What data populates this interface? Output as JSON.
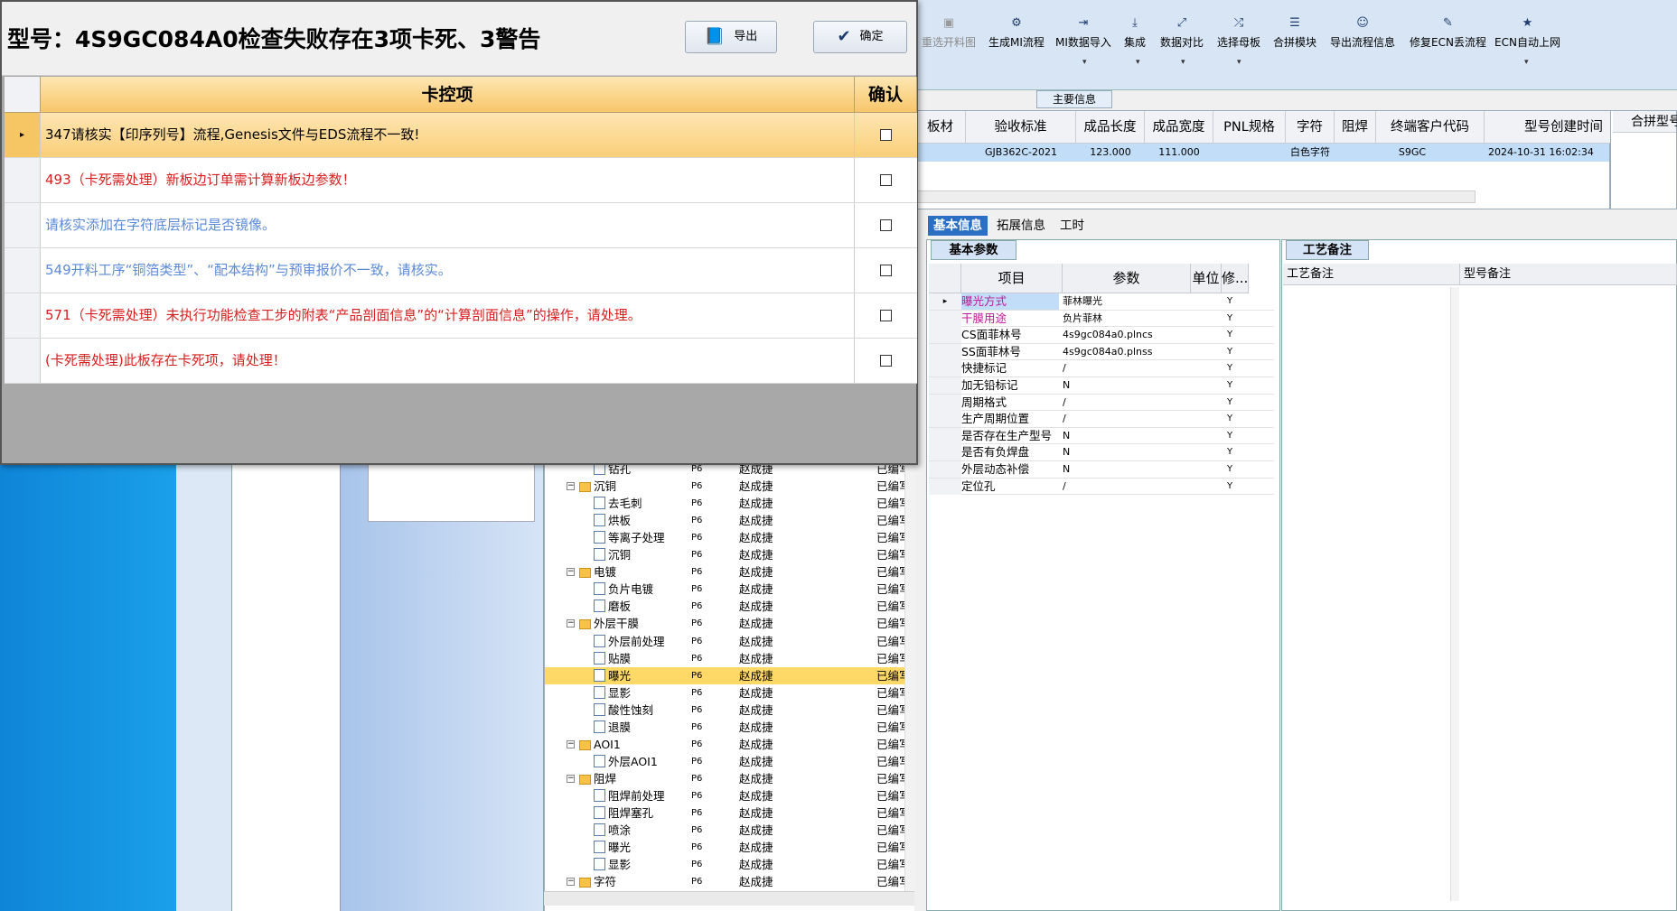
{
  "dialog": {
    "title": "型号：4S9GC084A0检查失败存在3项卡死、3警告",
    "export_label": "导出",
    "ok_label": "确定",
    "col_item": "卡控项",
    "col_confirm": "确认",
    "rows": [
      {
        "text": "347请核实【印序列号】流程,Genesis文件与EDS流程不一致!",
        "color": "#000000"
      },
      {
        "text": "493（卡死需处理）新板边订单需计算新板边参数！",
        "color": "#d81e1e"
      },
      {
        "text": "请核实添加在字符底层标记是否镜像。",
        "color": "#5a8ad8"
      },
      {
        "text": "549开料工序“铜箔类型”、“配本结构”与预审报价不一致，请核实。",
        "color": "#5a8ad8"
      },
      {
        "text": "571（卡死需处理）未执行功能检查工步的附表“产品剖面信息”的“计算剖面信息”的操作，请处理。",
        "color": "#d81e1e"
      },
      {
        "text": "(卡死需处理)此板存在卡死项，请处理！",
        "color": "#d81e1e"
      }
    ]
  },
  "toolbar": {
    "items": [
      "重选开料图",
      "生成MI流程",
      "MI数据导入",
      "集成",
      "数据对比",
      "选择母板",
      "合拼模块",
      "导出流程信息",
      "修复ECN丢流程",
      "ECN自动上网"
    ]
  },
  "main": {
    "section_label": "主要信息",
    "headers": [
      "板材",
      "验收标准",
      "成品长度",
      "成品宽度",
      "PNL规格",
      "字符",
      "阻焊",
      "终端客户代码",
      "型号创建时间"
    ],
    "row": [
      "GJB362C-2021",
      "123.000",
      "111.000",
      "白色字符",
      "S9GC",
      "2024-10-31 16:02:34"
    ],
    "right_header": "合拼型号"
  },
  "tabs": [
    "基本信息",
    "拓展信息",
    "工时"
  ],
  "params": {
    "subtab": "基本参数",
    "headers": [
      "项目",
      "参数",
      "单位",
      "修..."
    ],
    "rows": [
      {
        "item": "曝光方式",
        "value": "菲林曝光",
        "flag": "Y"
      },
      {
        "item": "干膜用途",
        "value": "负片菲林",
        "flag": "Y"
      },
      {
        "item": "CS面菲林号",
        "value": "4s9gc084a0.plncs",
        "flag": "Y"
      },
      {
        "item": "SS面菲林号",
        "value": "4s9gc084a0.plnss",
        "flag": "Y"
      },
      {
        "item": "快捷标记",
        "value": "/",
        "flag": "Y"
      },
      {
        "item": "加无铅标记",
        "value": "N",
        "flag": "Y"
      },
      {
        "item": "周期格式",
        "value": "/",
        "flag": "Y"
      },
      {
        "item": "生产周期位置",
        "value": "/",
        "flag": "Y"
      },
      {
        "item": "是否存在生产型号",
        "value": "N",
        "flag": "Y"
      },
      {
        "item": "是否有负焊盘",
        "value": "N",
        "flag": "Y"
      },
      {
        "item": "外层动态补偿",
        "value": "N",
        "flag": "Y"
      },
      {
        "item": "定位孔",
        "value": "/",
        "flag": "Y"
      }
    ]
  },
  "process": {
    "subtab": "工艺备注",
    "col1": "工艺备注",
    "col2": "型号备注"
  },
  "tree": {
    "rows": [
      {
        "name": "钻孔",
        "folder": false,
        "code": "P6",
        "user": "赵成捷",
        "status": "已编写"
      },
      {
        "name": "沉铜",
        "folder": true,
        "code": "P6",
        "user": "赵成捷",
        "status": "已编写"
      },
      {
        "name": "去毛刺",
        "folder": false,
        "code": "P6",
        "user": "赵成捷",
        "status": "已编写"
      },
      {
        "name": "烘板",
        "folder": false,
        "code": "P6",
        "user": "赵成捷",
        "status": "已编写"
      },
      {
        "name": "等离子处理",
        "folder": false,
        "code": "P6",
        "user": "赵成捷",
        "status": "已编写"
      },
      {
        "name": "沉铜",
        "folder": false,
        "code": "P6",
        "user": "赵成捷",
        "status": "已编写"
      },
      {
        "name": "电镀",
        "folder": true,
        "code": "P6",
        "user": "赵成捷",
        "status": "已编写"
      },
      {
        "name": "负片电镀",
        "folder": false,
        "code": "P6",
        "user": "赵成捷",
        "status": "已编写"
      },
      {
        "name": "磨板",
        "folder": false,
        "code": "P6",
        "user": "赵成捷",
        "status": "已编写"
      },
      {
        "name": "外层干膜",
        "folder": true,
        "code": "P6",
        "user": "赵成捷",
        "status": "已编写"
      },
      {
        "name": "外层前处理",
        "folder": false,
        "code": "P6",
        "user": "赵成捷",
        "status": "已编写"
      },
      {
        "name": "贴膜",
        "folder": false,
        "code": "P6",
        "user": "赵成捷",
        "status": "已编写"
      },
      {
        "name": "曝光",
        "folder": false,
        "code": "P6",
        "user": "赵成捷",
        "status": "已编写",
        "selected": true
      },
      {
        "name": "显影",
        "folder": false,
        "code": "P6",
        "user": "赵成捷",
        "status": "已编写"
      },
      {
        "name": "酸性蚀刻",
        "folder": false,
        "code": "P6",
        "user": "赵成捷",
        "status": "已编写"
      },
      {
        "name": "退膜",
        "folder": false,
        "code": "P6",
        "user": "赵成捷",
        "status": "已编写"
      },
      {
        "name": "AOI1",
        "folder": true,
        "code": "P6",
        "user": "赵成捷",
        "status": "已编写"
      },
      {
        "name": "外层AOI1",
        "folder": false,
        "code": "P6",
        "user": "赵成捷",
        "status": "已编写"
      },
      {
        "name": "阻焊",
        "folder": true,
        "code": "P6",
        "user": "赵成捷",
        "status": "已编写"
      },
      {
        "name": "阻焊前处理",
        "folder": false,
        "code": "P6",
        "user": "赵成捷",
        "status": "已编写"
      },
      {
        "name": "阻焊塞孔",
        "folder": false,
        "code": "P6",
        "user": "赵成捷",
        "status": "已编写"
      },
      {
        "name": "喷涂",
        "folder": false,
        "code": "P6",
        "user": "赵成捷",
        "status": "已编写"
      },
      {
        "name": "曝光",
        "folder": false,
        "code": "P6",
        "user": "赵成捷",
        "status": "已编写"
      },
      {
        "name": "显影",
        "folder": false,
        "code": "P6",
        "user": "赵成捷",
        "status": "已编写"
      },
      {
        "name": "字符",
        "folder": true,
        "code": "P6",
        "user": "赵成捷",
        "status": "已编写"
      }
    ]
  }
}
